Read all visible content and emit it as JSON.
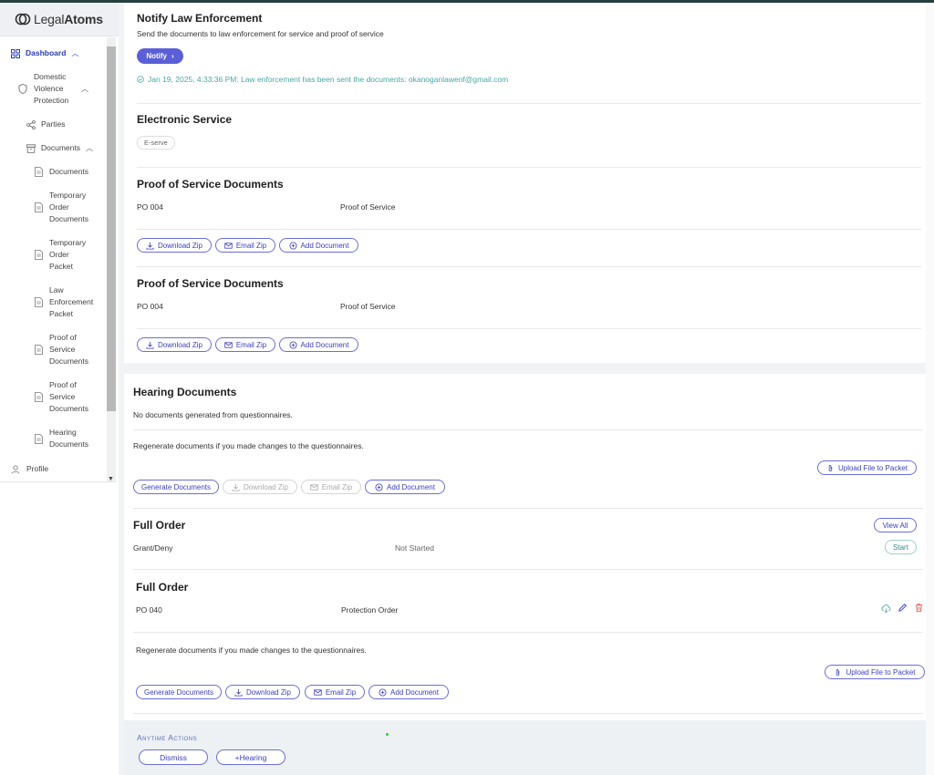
{
  "brand": {
    "logo_prefix": "Legal",
    "logo_suffix": "Atoms"
  },
  "sidebar": {
    "dashboard": "Dashboard",
    "dvp": "Domestic Violence Protection",
    "parties": "Parties",
    "documents_group": "Documents",
    "items": [
      "Documents",
      "Temporary Order Documents",
      "Temporary Order Packet",
      "Law Enforcement Packet",
      "Proof of Service Documents",
      "Proof of Service Documents",
      "Hearing Documents"
    ],
    "profile": "Profile"
  },
  "notify": {
    "title": "Notify Law Enforcement",
    "description": "Send the documents to law enforcement for service and proof of service",
    "button": "Notify",
    "status": "Jan 19, 2025, 4:33:36 PM: Law enforcement has been sent the documents: okanoganlawenf@gmail.com"
  },
  "eservice": {
    "title": "Electronic Service",
    "tag": "E-serve"
  },
  "pos1": {
    "title": "Proof of Service Documents",
    "row": {
      "code": "PO 004",
      "name": "Proof of Service"
    },
    "download": "Download Zip",
    "email": "Email Zip",
    "add": "Add Document"
  },
  "pos2": {
    "title": "Proof of Service Documents",
    "row": {
      "code": "PO 004",
      "name": "Proof of Service"
    },
    "download": "Download Zip",
    "email": "Email Zip",
    "add": "Add Document"
  },
  "hearing": {
    "title": "Hearing Documents",
    "empty": "No documents generated from questionnaires.",
    "regen": "Regenerate documents if you made changes to the questionnaires.",
    "upload": "Upload File to Packet",
    "generate": "Generate Documents",
    "download": "Download Zip",
    "email": "Email Zip",
    "add": "Add Document"
  },
  "full_order_1": {
    "title": "Full Order",
    "view_all": "View All",
    "row": {
      "name": "Grant/Deny",
      "status": "Not Started",
      "action": "Start"
    }
  },
  "full_order_2": {
    "title": "Full Order",
    "row": {
      "code": "PO 040",
      "name": "Protection Order"
    },
    "regen": "Regenerate documents if you made changes to the questionnaires.",
    "upload": "Upload File to Packet",
    "generate": "Generate Documents",
    "download": "Download Zip",
    "email": "Email Zip",
    "add": "Add Document"
  },
  "anytime": {
    "title": "Anytime Actions",
    "dismiss": "Dismiss",
    "hearing": "+Hearing"
  },
  "colors": {
    "accent": "#5a5fd8",
    "teal": "#4aa6a6",
    "danger": "#d9534f"
  }
}
